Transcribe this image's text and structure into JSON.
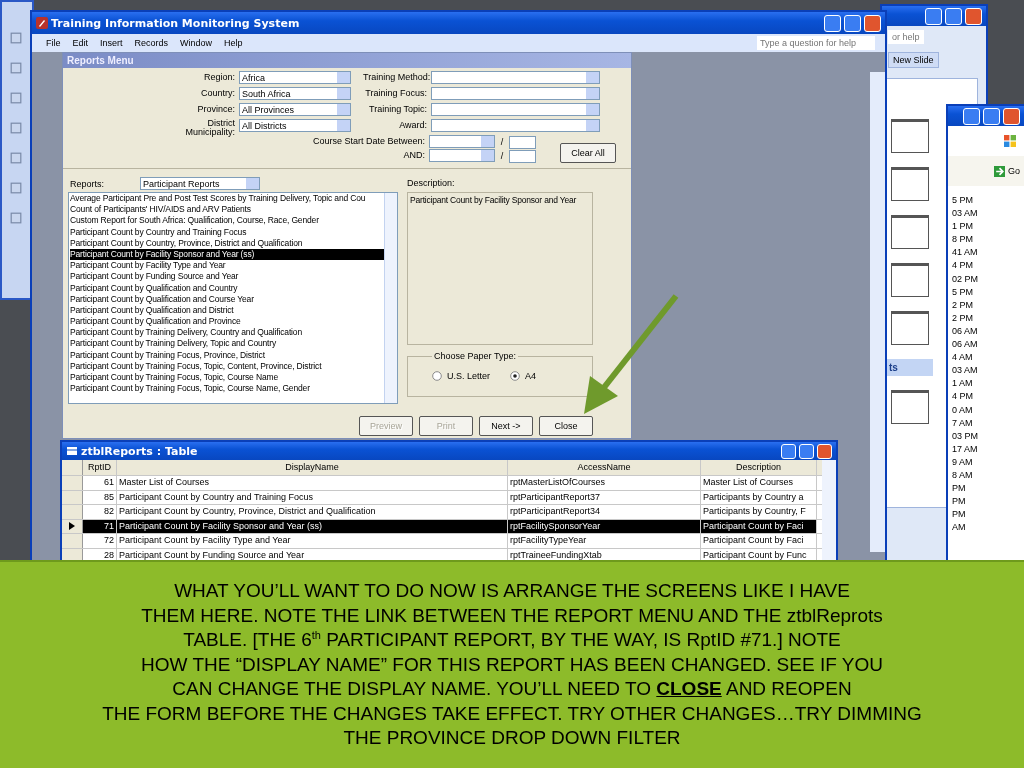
{
  "main_window": {
    "title": "Training Information Monitoring System",
    "menu": [
      "File",
      "Edit",
      "Insert",
      "Records",
      "Window",
      "Help"
    ],
    "help_placeholder": "Type a question for help"
  },
  "reports_menu": {
    "title": "Reports Menu",
    "filters_left": [
      {
        "label": "Region:",
        "value": "Africa"
      },
      {
        "label": "Country:",
        "value": "South Africa"
      },
      {
        "label": "Province:",
        "value": "All Provinces"
      },
      {
        "label": "District Municipality:",
        "value": "All Districts"
      }
    ],
    "filters_right": [
      {
        "label": "Training Method:"
      },
      {
        "label": "Training Focus:"
      },
      {
        "label": "Training Topic:"
      },
      {
        "label": "Award:"
      }
    ],
    "date_rows": [
      {
        "label": "Course Start Date Between:",
        "separator": "/"
      },
      {
        "label": "AND:",
        "separator": "/"
      }
    ],
    "clear_button": "Clear All",
    "reports_label": "Reports:",
    "report_type": "Participant Reports",
    "reports": [
      {
        "name": "Average Participant Pre and Post Test Scores by Training Delivery, Topic and Cou",
        "selected": false
      },
      {
        "name": "Count of Participants' HIV/AIDS and ARV Patients",
        "selected": false
      },
      {
        "name": "Custom Report for South Africa: Qualification, Course, Race, Gender",
        "selected": false
      },
      {
        "name": "Participant Count by Country and Training Focus",
        "selected": false
      },
      {
        "name": "Participant Count by Country, Province, District and Qualification",
        "selected": false
      },
      {
        "name": "Participant Count by Facility Sponsor and Year (ss)",
        "selected": true
      },
      {
        "name": "Participant Count by Facility Type and Year",
        "selected": false
      },
      {
        "name": "Participant Count by Funding Source and Year",
        "selected": false
      },
      {
        "name": "Participant Count by Qualification and Country",
        "selected": false
      },
      {
        "name": "Participant Count by Qualification and Course Year",
        "selected": false
      },
      {
        "name": "Participant Count by Qualification and District",
        "selected": false
      },
      {
        "name": "Participant Count by Qualification and Province",
        "selected": false
      },
      {
        "name": "Participant Count by Training Delivery, Country and Qualification",
        "selected": false
      },
      {
        "name": "Participant Count by Training Delivery, Topic and Country",
        "selected": false
      },
      {
        "name": "Participant Count by Training Focus, Province, District",
        "selected": false
      },
      {
        "name": "Participant Count by Training Focus, Topic, Content, Province, District",
        "selected": false
      },
      {
        "name": "Participant Count by Training Focus, Topic, Course Name",
        "selected": false
      },
      {
        "name": "Participant Count by Training Focus, Topic, Course Name, Gender",
        "selected": false
      }
    ],
    "description_label": "Description:",
    "description": "Participant Count by Facility Sponsor and Year",
    "paper_group": "Choose Paper Type:",
    "paper_types": [
      {
        "label": "U.S. Letter",
        "selected": false
      },
      {
        "label": "A4",
        "selected": true
      }
    ],
    "buttons": [
      {
        "label": "Preview",
        "disabled": true
      },
      {
        "label": "Print",
        "disabled": true
      },
      {
        "label": "Next ->",
        "disabled": false
      },
      {
        "label": "Close",
        "disabled": false
      }
    ]
  },
  "table_window": {
    "title": "ztblReports : Table",
    "columns": [
      "RptID",
      "DisplayName",
      "AccessName",
      "Description"
    ],
    "rows": [
      {
        "cells": [
          "61",
          "Master List of Courses",
          "rptMasterListOfCourses",
          "Master List of Courses"
        ],
        "selected": false
      },
      {
        "cells": [
          "85",
          "Participant Count by Country and Training Focus",
          "rptParticipantReport37",
          "Participants by Country a"
        ],
        "selected": false
      },
      {
        "cells": [
          "82",
          "Participant Count by Country, Province, District and Qualification",
          "rptParticipantReport34",
          "Participants by Country, F"
        ],
        "selected": false
      },
      {
        "cells": [
          "71",
          "Participant Count by Facility Sponsor and Year (ss)",
          "rptFacilitySponsorYear",
          "Participant Count by Faci"
        ],
        "selected": true
      },
      {
        "cells": [
          "72",
          "Participant Count by Facility Type and Year",
          "rptFacilityTypeYear",
          "Participant Count by Faci"
        ],
        "selected": false
      },
      {
        "cells": [
          "28",
          "Participant Count by Funding Source and Year",
          "rptTraineeFundingXtab",
          "Participant Count by Func"
        ],
        "selected": false
      }
    ]
  },
  "background": {
    "help_box": "or help",
    "new_slide": "New Slide",
    "section": "ts",
    "go": "Go",
    "times": [
      "5 PM",
      "03 AM",
      "1 PM",
      "8 PM",
      "41 AM",
      "4 PM",
      "02 PM",
      "5 PM",
      "2 PM",
      "2 PM",
      "06 AM",
      "06 AM",
      "4 AM",
      "03 AM",
      "1 AM",
      "4 PM",
      "0 AM",
      "7 AM",
      "03 PM",
      "17 AM",
      "9 AM",
      "8 AM",
      "PM",
      "PM",
      "PM",
      "AM"
    ]
  },
  "caption": {
    "lines": [
      "WHAT YOU’LL WANT TO DO NOW IS ARRANGE THE SCREENS LIKE I HAVE",
      "THEM HERE. NOTE THE LINK BETWEEN THE REPORT MENU AND THE ztblReprots",
      "TABLE. [THE 6$^{th}$ PARTICIPANT REPORT, BY THE WAY, IS RptID #71.] NOTE",
      "HOW THE “DISPLAY NAME” FOR THIS REPORT HAS BEEN CHANGED. SEE IF YOU",
      "CAN CHANGE THE DISPLAY NAME. YOU’LL NEED TO **CLOSE** AND REOPEN",
      "THE FORM BEFORE THE CHANGES TAKE EFFECT. TRY OTHER CHANGES…TRY DIMMING",
      "THE PROVINCE DROP DOWN FILTER"
    ]
  }
}
